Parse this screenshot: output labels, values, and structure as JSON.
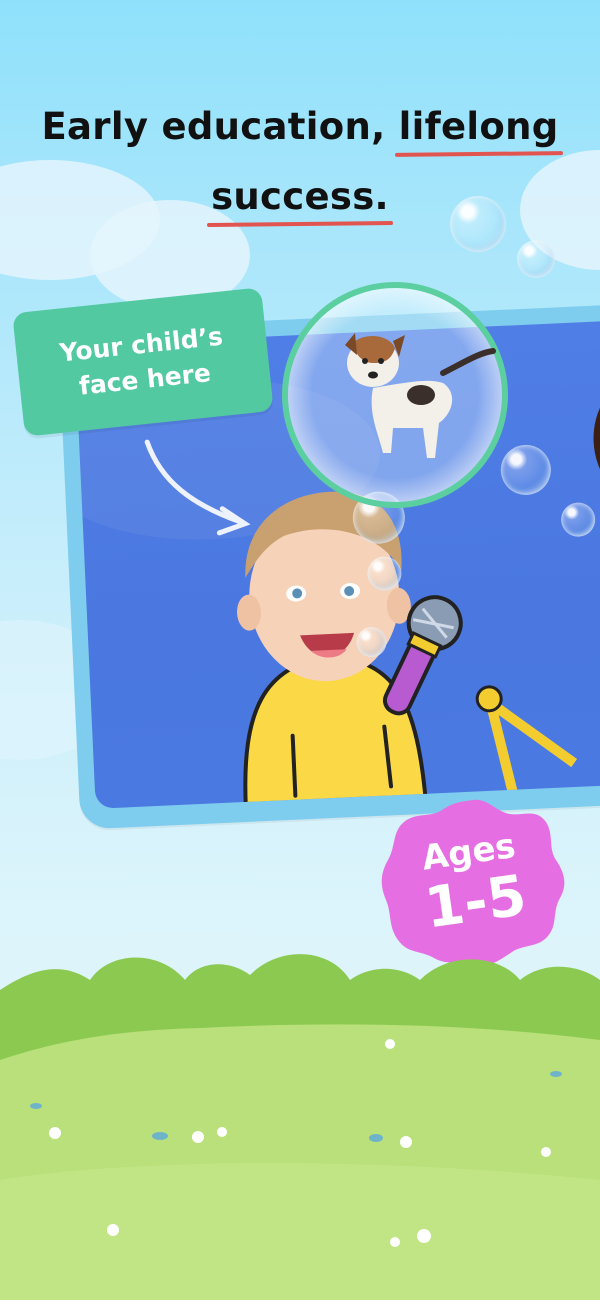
{
  "headline": {
    "line1_plain": "Early education, ",
    "line1_underlined": "lifelong",
    "line2_underlined": "success."
  },
  "tag": {
    "line1": "Your child’s",
    "line2": "face here"
  },
  "badge": {
    "line1": "Ages",
    "line2": "1-5"
  },
  "colors": {
    "sky_top": "#8fe1fb",
    "underline": "#e2544f",
    "tag_green": "#52c9a0",
    "badge_pink": "#e56fe2",
    "frame_blue": "#7fcdee",
    "screen_blue": "#4f7ee6",
    "grass": "#b9e07a"
  },
  "icons": [
    "puppy-illustration",
    "toddler-face-illustration",
    "microphone-icon",
    "arrow-doodle",
    "bubble"
  ]
}
